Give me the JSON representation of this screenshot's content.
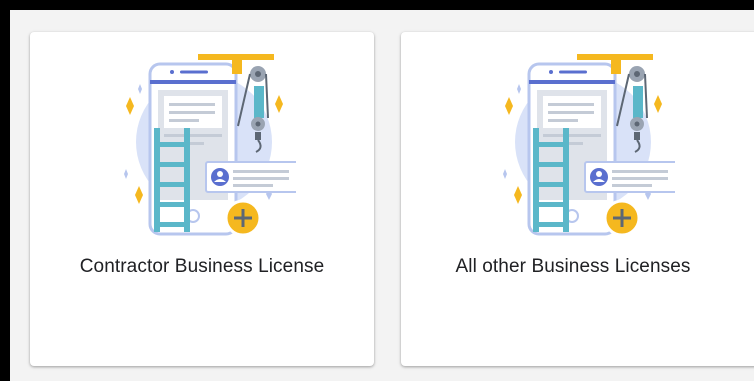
{
  "cards": [
    {
      "title": "Contractor Business License",
      "icon": "license-illustration-icon"
    },
    {
      "title": "All other Business Licenses",
      "icon": "license-illustration-icon"
    }
  ],
  "colors": {
    "accent_yellow": "#f5b81f",
    "accent_teal": "#5bb7c9",
    "phone_blue": "#5a6fcf",
    "bubble": "#d9e2f8",
    "page_bg": "#f3f3f3"
  }
}
